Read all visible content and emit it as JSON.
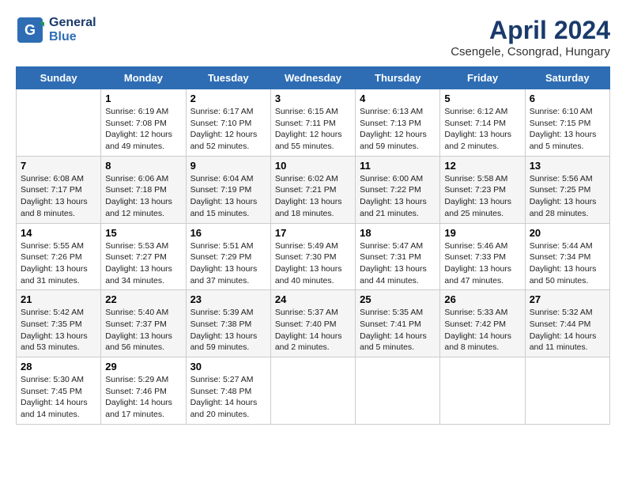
{
  "header": {
    "logo_line1": "General",
    "logo_line2": "Blue",
    "month_title": "April 2024",
    "location": "Csengele, Csongrad, Hungary"
  },
  "weekdays": [
    "Sunday",
    "Monday",
    "Tuesday",
    "Wednesday",
    "Thursday",
    "Friday",
    "Saturday"
  ],
  "weeks": [
    [
      {
        "day": "",
        "info": ""
      },
      {
        "day": "1",
        "info": "Sunrise: 6:19 AM\nSunset: 7:08 PM\nDaylight: 12 hours\nand 49 minutes."
      },
      {
        "day": "2",
        "info": "Sunrise: 6:17 AM\nSunset: 7:10 PM\nDaylight: 12 hours\nand 52 minutes."
      },
      {
        "day": "3",
        "info": "Sunrise: 6:15 AM\nSunset: 7:11 PM\nDaylight: 12 hours\nand 55 minutes."
      },
      {
        "day": "4",
        "info": "Sunrise: 6:13 AM\nSunset: 7:13 PM\nDaylight: 12 hours\nand 59 minutes."
      },
      {
        "day": "5",
        "info": "Sunrise: 6:12 AM\nSunset: 7:14 PM\nDaylight: 13 hours\nand 2 minutes."
      },
      {
        "day": "6",
        "info": "Sunrise: 6:10 AM\nSunset: 7:15 PM\nDaylight: 13 hours\nand 5 minutes."
      }
    ],
    [
      {
        "day": "7",
        "info": "Sunrise: 6:08 AM\nSunset: 7:17 PM\nDaylight: 13 hours\nand 8 minutes."
      },
      {
        "day": "8",
        "info": "Sunrise: 6:06 AM\nSunset: 7:18 PM\nDaylight: 13 hours\nand 12 minutes."
      },
      {
        "day": "9",
        "info": "Sunrise: 6:04 AM\nSunset: 7:19 PM\nDaylight: 13 hours\nand 15 minutes."
      },
      {
        "day": "10",
        "info": "Sunrise: 6:02 AM\nSunset: 7:21 PM\nDaylight: 13 hours\nand 18 minutes."
      },
      {
        "day": "11",
        "info": "Sunrise: 6:00 AM\nSunset: 7:22 PM\nDaylight: 13 hours\nand 21 minutes."
      },
      {
        "day": "12",
        "info": "Sunrise: 5:58 AM\nSunset: 7:23 PM\nDaylight: 13 hours\nand 25 minutes."
      },
      {
        "day": "13",
        "info": "Sunrise: 5:56 AM\nSunset: 7:25 PM\nDaylight: 13 hours\nand 28 minutes."
      }
    ],
    [
      {
        "day": "14",
        "info": "Sunrise: 5:55 AM\nSunset: 7:26 PM\nDaylight: 13 hours\nand 31 minutes."
      },
      {
        "day": "15",
        "info": "Sunrise: 5:53 AM\nSunset: 7:27 PM\nDaylight: 13 hours\nand 34 minutes."
      },
      {
        "day": "16",
        "info": "Sunrise: 5:51 AM\nSunset: 7:29 PM\nDaylight: 13 hours\nand 37 minutes."
      },
      {
        "day": "17",
        "info": "Sunrise: 5:49 AM\nSunset: 7:30 PM\nDaylight: 13 hours\nand 40 minutes."
      },
      {
        "day": "18",
        "info": "Sunrise: 5:47 AM\nSunset: 7:31 PM\nDaylight: 13 hours\nand 44 minutes."
      },
      {
        "day": "19",
        "info": "Sunrise: 5:46 AM\nSunset: 7:33 PM\nDaylight: 13 hours\nand 47 minutes."
      },
      {
        "day": "20",
        "info": "Sunrise: 5:44 AM\nSunset: 7:34 PM\nDaylight: 13 hours\nand 50 minutes."
      }
    ],
    [
      {
        "day": "21",
        "info": "Sunrise: 5:42 AM\nSunset: 7:35 PM\nDaylight: 13 hours\nand 53 minutes."
      },
      {
        "day": "22",
        "info": "Sunrise: 5:40 AM\nSunset: 7:37 PM\nDaylight: 13 hours\nand 56 minutes."
      },
      {
        "day": "23",
        "info": "Sunrise: 5:39 AM\nSunset: 7:38 PM\nDaylight: 13 hours\nand 59 minutes."
      },
      {
        "day": "24",
        "info": "Sunrise: 5:37 AM\nSunset: 7:40 PM\nDaylight: 14 hours\nand 2 minutes."
      },
      {
        "day": "25",
        "info": "Sunrise: 5:35 AM\nSunset: 7:41 PM\nDaylight: 14 hours\nand 5 minutes."
      },
      {
        "day": "26",
        "info": "Sunrise: 5:33 AM\nSunset: 7:42 PM\nDaylight: 14 hours\nand 8 minutes."
      },
      {
        "day": "27",
        "info": "Sunrise: 5:32 AM\nSunset: 7:44 PM\nDaylight: 14 hours\nand 11 minutes."
      }
    ],
    [
      {
        "day": "28",
        "info": "Sunrise: 5:30 AM\nSunset: 7:45 PM\nDaylight: 14 hours\nand 14 minutes."
      },
      {
        "day": "29",
        "info": "Sunrise: 5:29 AM\nSunset: 7:46 PM\nDaylight: 14 hours\nand 17 minutes."
      },
      {
        "day": "30",
        "info": "Sunrise: 5:27 AM\nSunset: 7:48 PM\nDaylight: 14 hours\nand 20 minutes."
      },
      {
        "day": "",
        "info": ""
      },
      {
        "day": "",
        "info": ""
      },
      {
        "day": "",
        "info": ""
      },
      {
        "day": "",
        "info": ""
      }
    ]
  ]
}
